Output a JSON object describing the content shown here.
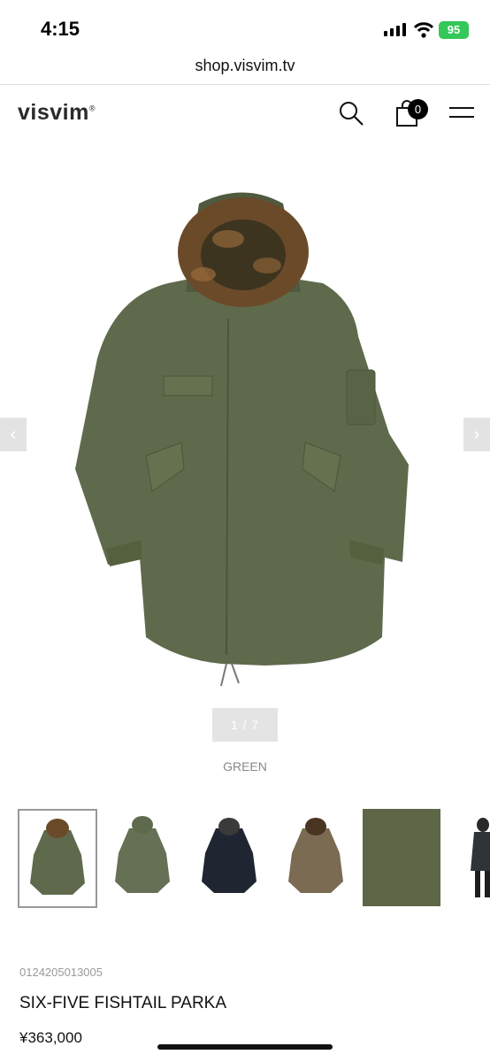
{
  "status": {
    "time": "4:15",
    "battery": "95"
  },
  "browser": {
    "url": "shop.visvim.tv"
  },
  "header": {
    "logo": "visvim",
    "cart_count": "0"
  },
  "gallery": {
    "pager": "1 / 7",
    "color": "GREEN"
  },
  "product": {
    "code": "0124205013005",
    "name": "SIX-FIVE FISHTAIL PARKA",
    "price": "¥363,000"
  },
  "colors": {
    "olive": "#5f6a4c",
    "navy": "#1f2531",
    "brown": "#7a6b52",
    "fur": "#6b4a2a"
  }
}
